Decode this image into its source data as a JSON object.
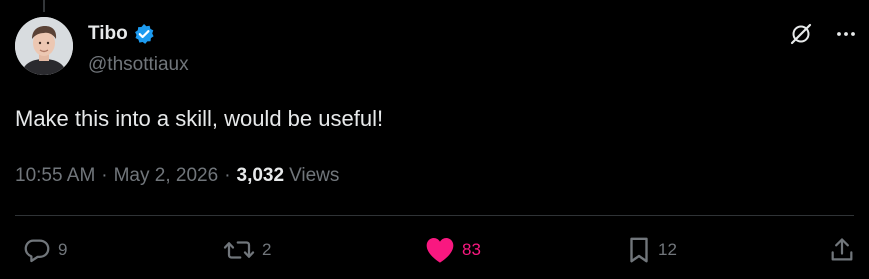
{
  "author": {
    "display_name": "Tibo",
    "handle": "@thsottiaux",
    "verified": true
  },
  "tweet": {
    "text": "Make this into a skill, would be useful!",
    "time": "10:55 AM",
    "separator": "·",
    "date": "May 2, 2026",
    "views_count": "3,032",
    "views_label": "Views"
  },
  "actions": {
    "replies": "9",
    "reposts": "2",
    "likes": "83",
    "bookmarks": "12"
  },
  "icons": {
    "verified": "verified-badge-icon",
    "grok": "grok-icon",
    "more": "more-icon",
    "reply": "reply-icon",
    "repost": "repost-icon",
    "like": "heart-icon",
    "bookmark": "bookmark-icon",
    "share": "share-icon"
  },
  "colors": {
    "background": "#000000",
    "primary_text": "#e7e9ea",
    "secondary_text": "#71767b",
    "verified_blue": "#1d9bf0",
    "like_pink": "#f91880",
    "divider": "#2f3336"
  }
}
